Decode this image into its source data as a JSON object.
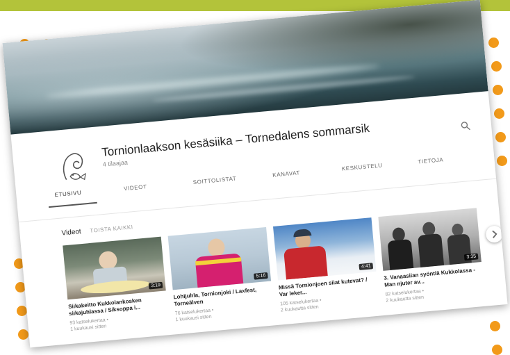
{
  "channel": {
    "title": "Tornionlaakson kesäsiika – Tornedalens sommarsik",
    "subscribers": "4 tilaajaa"
  },
  "tabs": [
    "ETUSIVU",
    "VIDEOT",
    "SOITTOLISTAT",
    "KANAVAT",
    "KESKUSTELU",
    "TIETOJA"
  ],
  "section": {
    "title": "Videot",
    "play_all": "TOISTA KAIKKI"
  },
  "videos": [
    {
      "title": "Siikakeitto Kukkolankosken siikajuhlassa / Siksoppa i...",
      "views": "93 katselukertaa •",
      "age": "1 kuukausi sitten",
      "duration": "3:19"
    },
    {
      "title": "Lohijuhla, Tornionjoki / Laxfest, Torneälven",
      "views": "76 katselukertaa •",
      "age": "1 kuukausi sitten",
      "duration": "5:16"
    },
    {
      "title": "Missä Tornionjoen siiat kutevat? / Var leker...",
      "views": "105 katselukertaa •",
      "age": "2 kuukautta sitten",
      "duration": "4:41"
    },
    {
      "title": "3. Vanaasiian syöntiä Kukkolassa - Man njuter av...",
      "views": "82 katselukertaa •",
      "age": "2 kuukautta sitten",
      "duration": "3:35"
    }
  ],
  "icons": {
    "search": "search-icon",
    "next": "chevron-right-icon",
    "avatar": "fish-logo"
  },
  "colors": {
    "accent_band": "#b3c33a",
    "dots": "#f29a1a"
  }
}
